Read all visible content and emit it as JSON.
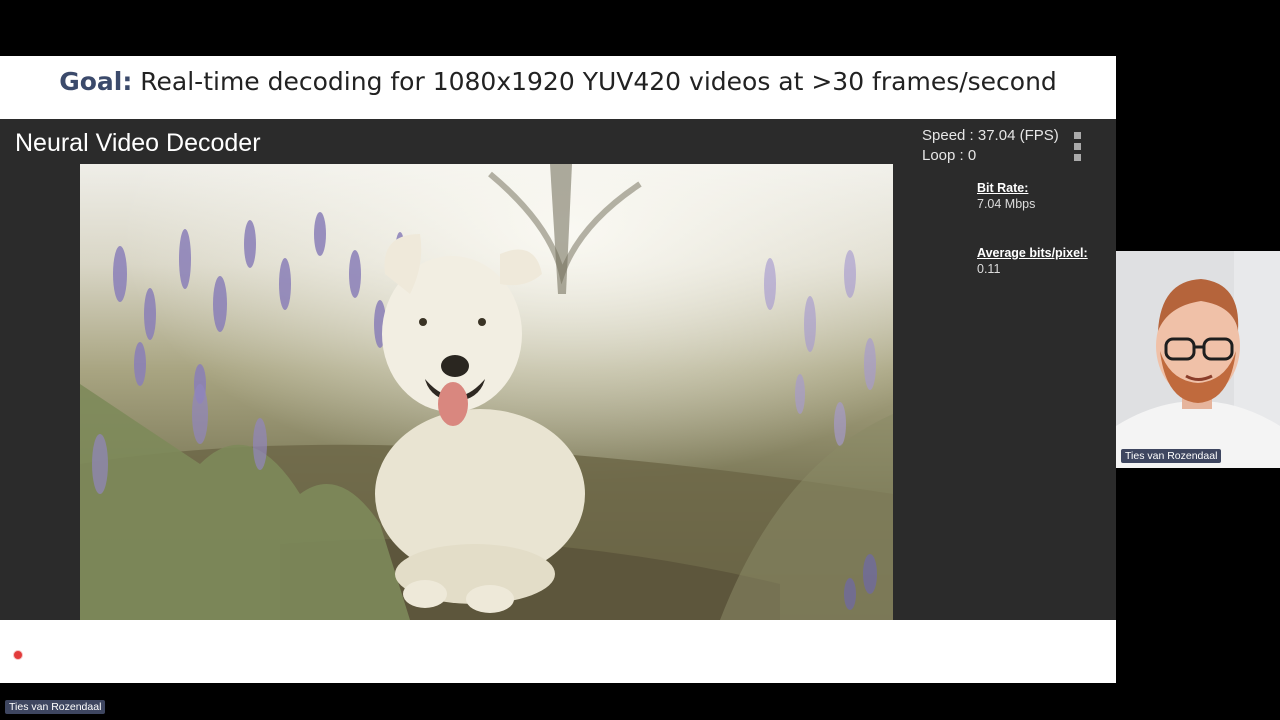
{
  "slide": {
    "goal_label": "Goal:",
    "goal_text": " Real-time decoding for 1080x1920 YUV420 videos at >30 frames/second"
  },
  "app": {
    "title": "Neural Video Decoder",
    "speed": "Speed : 37.04 (FPS)",
    "loop": "Loop : 0",
    "bit_rate_label": "Bit Rate:",
    "bit_rate_value": "7.04 Mbps",
    "bpp_label": "Average bits/pixel:",
    "bpp_value": "0.11"
  },
  "participants": {
    "presenter_name": "Ties van Rozendaal",
    "self_view_name": "Ties van Rozendaal"
  },
  "colors": {
    "background": "#000000",
    "app_background": "#2b2b2b",
    "goal_label": "#3b4a6b",
    "name_tag": "#3e4660",
    "record_dot": "#e23b3b"
  },
  "icons": [
    "more-options-icon",
    "recording-indicator-icon"
  ]
}
